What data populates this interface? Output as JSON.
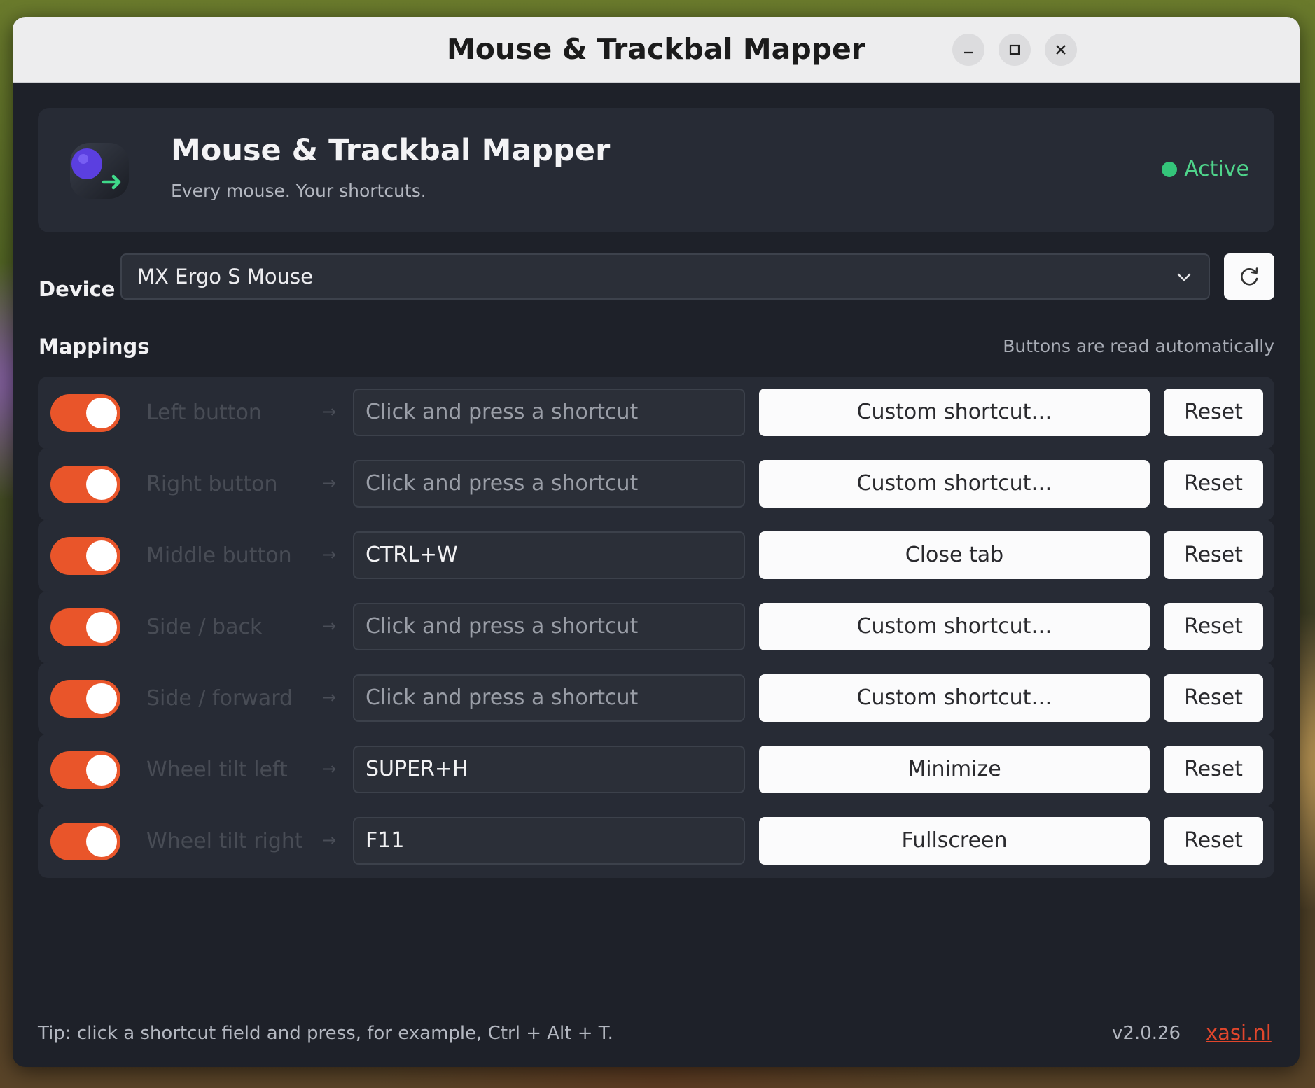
{
  "window": {
    "title": "Mouse & Trackbal Mapper",
    "controls": {
      "minimize": "minimize-icon",
      "maximize": "maximize-icon",
      "close": "close-icon"
    }
  },
  "header": {
    "app_name": "Mouse & Trackbal Mapper",
    "tagline": "Every mouse. Your shortcuts.",
    "status": "Active",
    "status_color": "#34c57a",
    "icon": "mouse-arrow-icon"
  },
  "device": {
    "label": "Device",
    "selected": "MX Ergo S Mouse",
    "refresh_icon": "refresh-icon"
  },
  "mappings": {
    "label": "Mappings",
    "note": "Buttons are read automatically",
    "placeholder": "Click and press a shortcut",
    "arrow": "→",
    "reset_label": "Reset",
    "rows": [
      {
        "button": "Left button",
        "enabled": true,
        "shortcut": "",
        "action": "Custom shortcut…"
      },
      {
        "button": "Right button",
        "enabled": true,
        "shortcut": "",
        "action": "Custom shortcut…"
      },
      {
        "button": "Middle button",
        "enabled": true,
        "shortcut": "CTRL+W",
        "action": "Close tab"
      },
      {
        "button": "Side / back",
        "enabled": true,
        "shortcut": "",
        "action": "Custom shortcut…"
      },
      {
        "button": "Side / forward",
        "enabled": true,
        "shortcut": "",
        "action": "Custom shortcut…"
      },
      {
        "button": "Wheel tilt left",
        "enabled": true,
        "shortcut": "SUPER+H",
        "action": "Minimize"
      },
      {
        "button": "Wheel tilt right",
        "enabled": true,
        "shortcut": "F11",
        "action": "Fullscreen"
      }
    ]
  },
  "footer": {
    "tip": "Tip: click a shortcut field and press, for example, Ctrl + Alt + T.",
    "version": "v2.0.26",
    "link": "xasi.nl"
  },
  "colors": {
    "accent": "#e9552a",
    "background": "#1e2129",
    "card": "#272b35",
    "link": "#e1462c"
  }
}
